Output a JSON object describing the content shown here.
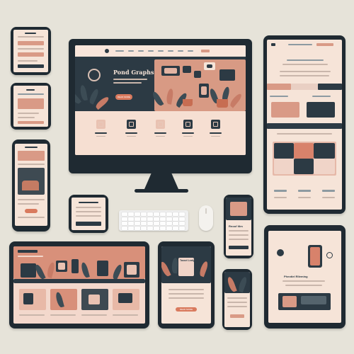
{
  "hero": {
    "title": "Pond Graphs",
    "cta": "READ MORE"
  },
  "monitor": {
    "nav_items": [
      "",
      "",
      "",
      "",
      "",
      "",
      "",
      "",
      ""
    ]
  },
  "tablet_bottom_center": {
    "heading": "Tassel Leafy",
    "cta": "READ MORE"
  },
  "phone_mid_right": {
    "heading": "Rnoof ltlm"
  },
  "tablet_right_bottom": {
    "heading": "Pheotiel Rlleming"
  },
  "colors": {
    "background": "#e6e3d9",
    "device": "#1f2a32",
    "screen": "#f6e4d8",
    "accent": "#d97a5e",
    "dark": "#2c3a44"
  }
}
